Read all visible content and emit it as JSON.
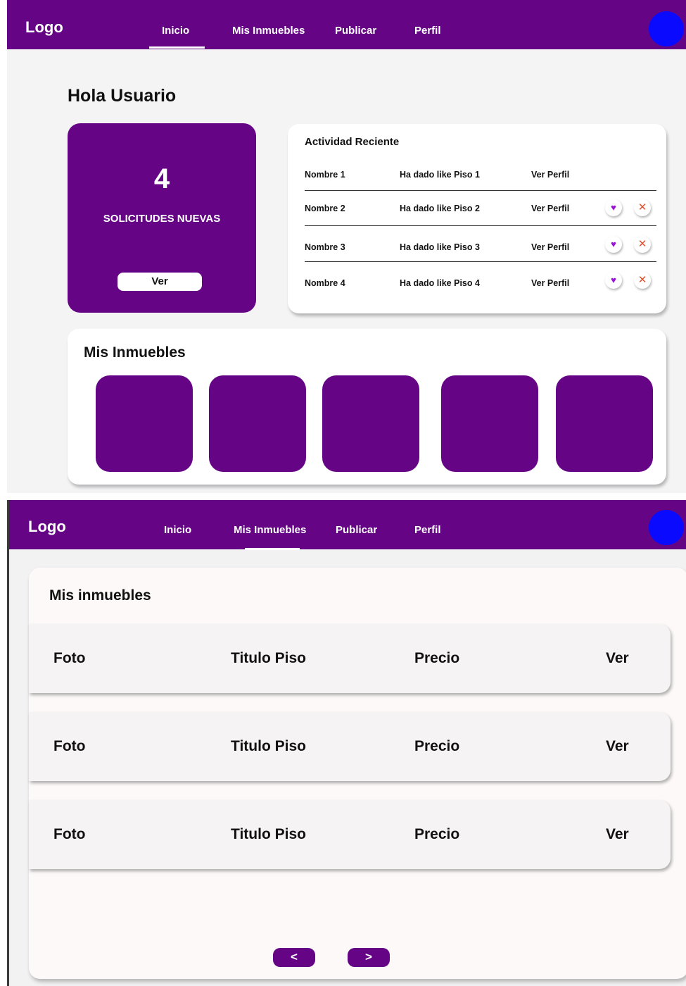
{
  "brand": {
    "logo": "Logo",
    "primary_color": "#650585",
    "avatar_color": "#0a0aff"
  },
  "nav": {
    "items": [
      {
        "label": "Inicio"
      },
      {
        "label": "Mis Inmuebles"
      },
      {
        "label": "Publicar"
      },
      {
        "label": "Perfil"
      }
    ]
  },
  "dashboard": {
    "active_tab": "Inicio",
    "greeting": "Hola Usuario",
    "requests": {
      "count": "4",
      "label": "SOLICITUDES NUEVAS",
      "button": "Ver"
    },
    "activity": {
      "title": "Actividad Reciente",
      "rows": [
        {
          "name": "Nombre 1",
          "action": "Ha dado like Piso 1",
          "link": "Ver Perfil"
        },
        {
          "name": "Nombre 2",
          "action": "Ha dado like Piso 2",
          "link": "Ver Perfil",
          "accept_icon": "heart-icon",
          "reject_icon": "close-icon"
        },
        {
          "name": "Nombre 3",
          "action": "Ha dado like Piso 3",
          "link": "Ver Perfil",
          "accept_icon": "heart-icon",
          "reject_icon": "close-icon"
        },
        {
          "name": "Nombre 4",
          "action": "Ha dado like Piso 4",
          "link": "Ver Perfil",
          "accept_icon": "heart-icon",
          "reject_icon": "close-icon"
        }
      ]
    },
    "properties": {
      "title": "Mis Inmuebles",
      "tile_count": 5
    }
  },
  "listing": {
    "active_tab": "Mis Inmuebles",
    "title": "Mis inmuebles",
    "rows": [
      {
        "photo": "Foto",
        "title": "Titulo Piso",
        "price": "Precio",
        "view": "Ver"
      },
      {
        "photo": "Foto",
        "title": "Titulo Piso",
        "price": "Precio",
        "view": "Ver"
      },
      {
        "photo": "Foto",
        "title": "Titulo Piso",
        "price": "Precio",
        "view": "Ver"
      }
    ],
    "pagination": {
      "prev": "<",
      "next": ">"
    }
  }
}
